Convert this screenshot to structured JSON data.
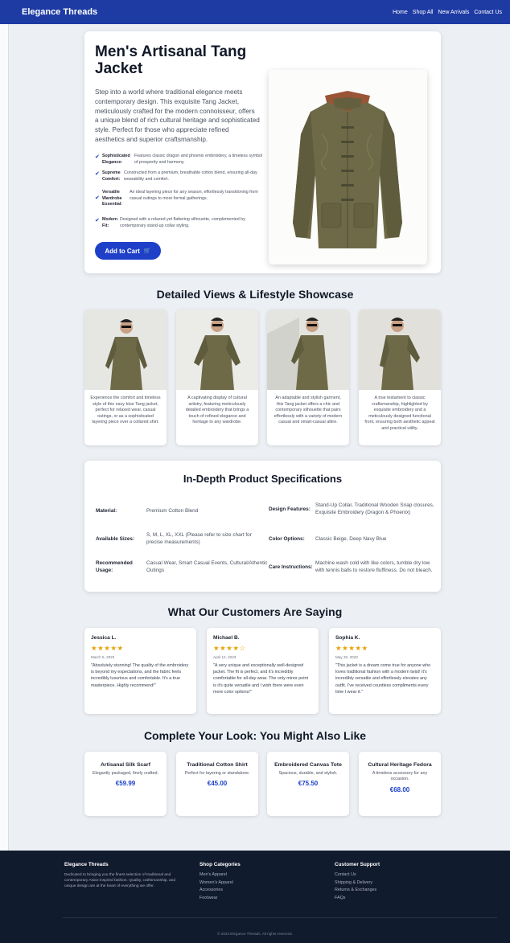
{
  "nav": {
    "brand": "Elegance Threads",
    "links": [
      "Home",
      "Shop All",
      "New Arrivals",
      "Contact Us"
    ]
  },
  "hero": {
    "title": "Men's Artisanal Tang Jacket",
    "description": "Step into a world where traditional elegance meets contemporary design. This exquisite Tang Jacket, meticulously crafted for the modern connoisseur, offers a unique blend of rich cultural heritage and sophisticated style. Perfect for those who appreciate refined aesthetics and superior craftsmanship.",
    "features": [
      {
        "title": "Sophisticated Elegance:",
        "text": "Features classic dragon and phoenix embroidery, a timeless symbol of prosperity and harmony."
      },
      {
        "title": "Supreme Comfort:",
        "text": "Constructed from a premium, breathable cotton blend, ensuring all-day wearability and comfort."
      },
      {
        "title": "Versatile Wardrobe Essential:",
        "text": "An ideal layering piece for any season, effortlessly transitioning from casual outings to more formal gatherings."
      },
      {
        "title": "Modern Fit:",
        "text": "Designed with a relaxed yet flattering silhouette, complemented by contemporary stand-up collar styling."
      }
    ],
    "cart_label": "Add to Cart"
  },
  "views": {
    "title": "Detailed Views & Lifestyle Showcase",
    "cards": [
      "Experience the comfort and timeless style of this navy blue Tang jacket, perfect for relaxed wear, casual outings, or as a sophisticated layering piece over a collared shirt.",
      "A captivating display of cultural artistry, featuring meticulously detailed embroidery that brings a touch of refined elegance and heritage to any wardrobe.",
      "An adaptable and stylish garment, this Tang jacket offers a chic and contemporary silhouette that pairs effortlessly with a variety of modern casual and smart-casual attire.",
      "A true testament to classic craftsmanship, highlighted by exquisite embroidery and a meticulously designed functional front, ensuring both aesthetic appeal and practical utility."
    ]
  },
  "specs": {
    "title": "In-Depth Product Specifications",
    "items": [
      {
        "label": "Material:",
        "value": "Premium Cotton Blend"
      },
      {
        "label": "Design Features:",
        "value": "Stand-Up Collar, Traditional Wooden Snap closures, Exquisite Embroidery (Dragon & Phoenix)"
      },
      {
        "label": "Available Sizes:",
        "value": "S, M, L, XL, XXL (Please refer to size chart for precise measurements)"
      },
      {
        "label": "Color Options:",
        "value": "Classic Beige, Deep Navy Blue"
      },
      {
        "label": "Recommended Usage:",
        "value": "Casual Wear, Smart Casual Events, Cultural/Athentic Outings"
      },
      {
        "label": "Care Instructions:",
        "value": "Machine wash cold with like colors, tumble dry low with tennis balls to restore fluffiness. Do not bleach."
      }
    ]
  },
  "reviews": {
    "title": "What Our Customers Are Saying",
    "items": [
      {
        "name": "Jessica L.",
        "stars": "★★★★★",
        "date": "March 5, 2023",
        "text": "\"Absolutely stunning! The quality of the embroidery is beyond my expectations, and the fabric feels incredibly luxurious and comfortable. It's a true masterpiece. Highly recommend!\""
      },
      {
        "name": "Michael B.",
        "stars": "★★★★☆",
        "date": "April 12, 2023",
        "text": "\"A very unique and exceptionally well-designed jacket. The fit is perfect, and it's incredibly comfortable for all-day wear. The only minor point is it's quite versatile and I wish there were even more color options!\""
      },
      {
        "name": "Sophia K.",
        "stars": "★★★★★",
        "date": "May 20, 2023",
        "text": "\"This jacket is a dream come true for anyone who loves traditional fashion with a modern twist! It's incredibly versatile and effortlessly elevates any outfit. I've received countless compliments every time I wear it.\""
      }
    ]
  },
  "related": {
    "title": "Complete Your Look: You Might Also Like",
    "items": [
      {
        "name": "Artisanal Silk Scarf",
        "desc": "Elegantly packaged, finely crafted.",
        "price": "€59.99"
      },
      {
        "name": "Traditional Cotton Shirt",
        "desc": "Perfect for layering or standalone.",
        "price": "€45.00"
      },
      {
        "name": "Embroidered Canvas Tote",
        "desc": "Spacious, durable, and stylish.",
        "price": "€75.50"
      },
      {
        "name": "Cultural Heritage Fedora",
        "desc": "A timeless accessory for any occasion.",
        "price": "€68.00"
      }
    ]
  },
  "footer": {
    "brand": "Elegance Threads",
    "about": "Dedicated to bringing you the finest selection of traditional and contemporary Asian-inspired fashion. Quality, craftsmanship, and unique design are at the heart of everything we offer.",
    "shop_title": "Shop Categories",
    "shop_links": [
      "Men's Apparel",
      "Women's Apparel",
      "Accessories",
      "Footwear"
    ],
    "support_title": "Customer Support",
    "support_links": [
      "Contact Us",
      "Shipping & Delivery",
      "Returns & Exchanges",
      "FAQs"
    ],
    "copyright": "© 2023 Elegance Threads. All rights reserved."
  },
  "colors": {
    "nav": "#1e3ba4",
    "accent": "#1e40c8",
    "star": "#e6a100",
    "footer": "#111b2e",
    "jacket": "#6e6a48"
  }
}
